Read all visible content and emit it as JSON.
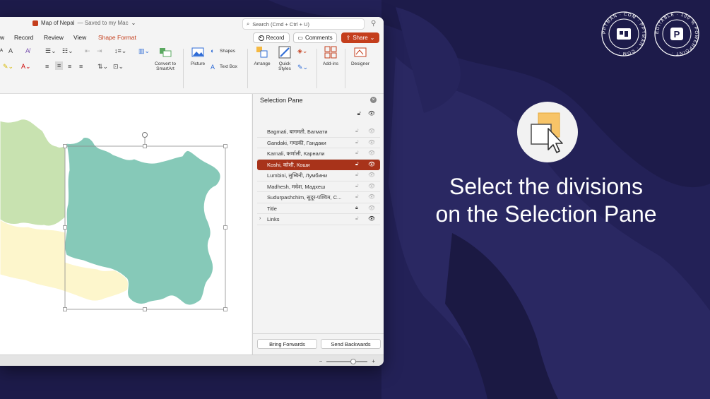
{
  "window": {
    "doc_title": "Map of Nepal",
    "saved_text": "— Saved to my Mac",
    "search_placeholder": "Search (Cmd + Ctrl + U)"
  },
  "tabs": [
    {
      "label": "w"
    },
    {
      "label": "Record"
    },
    {
      "label": "Review"
    },
    {
      "label": "View"
    },
    {
      "label": "Shape Format"
    }
  ],
  "actions": {
    "record": "Record",
    "comments": "Comments",
    "share": "Share"
  },
  "ribbon": {
    "convert_smartart": "Convert to SmartArt",
    "picture": "Picture",
    "shapes": "Shapes",
    "text_box": "Text Box",
    "arrange": "Arrange",
    "quick_styles": "Quick Styles",
    "add_ins": "Add-ins",
    "designer": "Designer"
  },
  "selection_pane": {
    "title": "Selection Pane",
    "items": [
      {
        "label": "Bagmati, बागमती, Багмати"
      },
      {
        "label": "Gandaki, गण्डकी, Гандаки"
      },
      {
        "label": "Karnali, कर्णाली, Карнали"
      },
      {
        "label": "Koshi, कोशी, Коши",
        "selected": true
      },
      {
        "label": "Lumbini, लुम्बिनी, Лумбини"
      },
      {
        "label": "Madhesh, मधेश, Мадхеш"
      },
      {
        "label": "Sudurpashchim, सुदूर-पश्चिम, С..."
      },
      {
        "label": "Title",
        "locked": true
      },
      {
        "label": "Links",
        "expandable": true
      }
    ],
    "bring_forwards": "Bring Forwards",
    "send_backwards": "Send Backwards"
  },
  "headline": {
    "line1": "Select the divisions",
    "line2": "on the Selection Pane"
  },
  "badges": {
    "pptman_text": "PPTMAN · COM · PPTMAN · COM ·",
    "editable_text": "EDITABLE · 100 % POWERPOINT ·"
  },
  "colors": {
    "background": "#1d1b4a",
    "accent": "#c43e1c",
    "selected_row": "#a8331a",
    "koshi_fill": "#86c9b8",
    "west_green": "#c8e2b0",
    "south_yellow": "#fdf6cc"
  }
}
